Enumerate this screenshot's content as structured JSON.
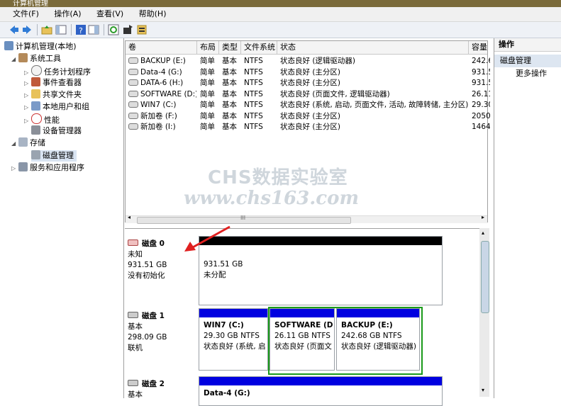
{
  "window_title": "计算机管理",
  "menu": [
    "文件(F)",
    "操作(A)",
    "查看(V)",
    "帮助(H)"
  ],
  "tree": {
    "root": "计算机管理(本地)",
    "system_tools": "系统工具",
    "items": [
      "任务计划程序",
      "事件查看器",
      "共享文件夹",
      "本地用户和组",
      "性能",
      "设备管理器"
    ],
    "storage": "存储",
    "disk_mgmt": "磁盘管理",
    "services": "服务和应用程序"
  },
  "columns": [
    "卷",
    "布局",
    "类型",
    "文件系统",
    "状态",
    "容量"
  ],
  "volumes": [
    {
      "name": "BACKUP (E:)",
      "layout": "简单",
      "type": "基本",
      "fs": "NTFS",
      "status": "状态良好 (逻辑驱动器)",
      "cap": "242.6"
    },
    {
      "name": "Data-4 (G:)",
      "layout": "简单",
      "type": "基本",
      "fs": "NTFS",
      "status": "状态良好 (主分区)",
      "cap": "931.5"
    },
    {
      "name": "DATA-6 (H:)",
      "layout": "简单",
      "type": "基本",
      "fs": "NTFS",
      "status": "状态良好 (主分区)",
      "cap": "931.5"
    },
    {
      "name": "SOFTWARE (D:)",
      "layout": "简单",
      "type": "基本",
      "fs": "NTFS",
      "status": "状态良好 (页面文件, 逻辑驱动器)",
      "cap": "26.11"
    },
    {
      "name": "WIN7 (C:)",
      "layout": "简单",
      "type": "基本",
      "fs": "NTFS",
      "status": "状态良好 (系统, 启动, 页面文件, 活动, 故障转储, 主分区)",
      "cap": "29.30"
    },
    {
      "name": "新加卷 (F:)",
      "layout": "简单",
      "type": "基本",
      "fs": "NTFS",
      "status": "状态良好 (主分区)",
      "cap": "2050."
    },
    {
      "name": "新加卷 (I:)",
      "layout": "简单",
      "type": "基本",
      "fs": "NTFS",
      "status": "状态良好 (主分区)",
      "cap": "1464."
    }
  ],
  "hscroll_thumb": "III",
  "watermark": {
    "line1": "CHS数据实验室",
    "line2": "www.chs163.com"
  },
  "disks": [
    {
      "name": "磁盘 0",
      "type": "未知",
      "size": "931.51 GB",
      "state": "没有初始化",
      "partitions": [
        {
          "title": "",
          "size": "931.51 GB",
          "status": "未分配"
        }
      ]
    },
    {
      "name": "磁盘 1",
      "type": "基本",
      "size": "298.09 GB",
      "state": "联机",
      "partitions": [
        {
          "title": "WIN7  (C:)",
          "size": "29.30 GB NTFS",
          "status": "状态良好 (系统, 启"
        },
        {
          "title": "SOFTWARE  (D",
          "size": "26.11 GB NTFS",
          "status": "状态良好 (页面文"
        },
        {
          "title": "BACKUP  (E:)",
          "size": "242.68 GB NTFS",
          "status": "状态良好 (逻辑驱动器)"
        }
      ]
    },
    {
      "name": "磁盘 2",
      "type": "基本",
      "size": "",
      "state": "",
      "partitions": [
        {
          "title": "Data-4  (G:)",
          "size": "",
          "status": ""
        }
      ]
    }
  ],
  "actions": {
    "header": "操作",
    "section": "磁盘管理",
    "more": "更多操作"
  },
  "colors": {
    "primary_bar": "#0000e0",
    "unallocated_bar": "#000000",
    "logical_border": "#1a9a1a",
    "arrow": "#e02020"
  }
}
